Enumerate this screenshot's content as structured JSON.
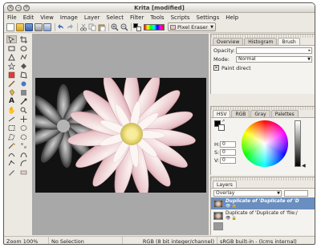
{
  "window": {
    "title": "Krita [modified]"
  },
  "menubar": [
    "File",
    "Edit",
    "View",
    "Image",
    "Layer",
    "Select",
    "Filter",
    "Tools",
    "Scripts",
    "Settings",
    "Help"
  ],
  "toolbar": {
    "icons": [
      "new-document-icon",
      "open-icon",
      "save-icon",
      "print-icon",
      "print-preview-icon",
      "undo-icon",
      "redo-icon",
      "cut-icon",
      "copy-icon",
      "paste-icon",
      "zoom-in-icon",
      "zoom-out-icon"
    ],
    "preset": "Pixel Eraser"
  },
  "brush_panel": {
    "tabs": [
      "Overview",
      "Histogram",
      "Brush"
    ],
    "active_tab": "Brush",
    "opacity_label": "Opacity:",
    "opacity_value": "",
    "mode_label": "Mode:",
    "mode_value": "Normal",
    "paint_direct_label": "Paint direct",
    "paint_direct_checked": true
  },
  "color_panel": {
    "tabs": [
      "HSV",
      "RGB",
      "Gray",
      "Palettes"
    ],
    "active_tab": "HSV",
    "h_label": "H:",
    "s_label": "S:",
    "v_label": "V:",
    "h_value": "0",
    "s_value": "0",
    "v_value": "0",
    "fg_color": "#000000",
    "bg_color": "#ffffff"
  },
  "layers_panel": {
    "tab": "Layers",
    "blend_mode": "Overlay",
    "layers": [
      {
        "name": "Duplicate of 'Duplicate of 'D",
        "selected": true
      },
      {
        "name": "Duplicate of 'Duplicate of 'file:/",
        "selected": false
      },
      {
        "name": "",
        "selected": false
      }
    ]
  },
  "statusbar": {
    "zoom": "Zoom 100%",
    "selection": "No Selection",
    "color_model": "RGB (8 bit integer/channel)",
    "profile": "sRGB built-in - (lcms internal)"
  }
}
